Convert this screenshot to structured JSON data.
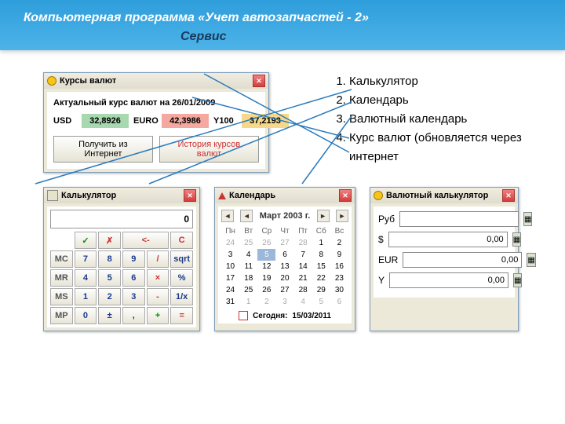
{
  "header": {
    "title": "Компьютерная программа «Учет автозапчастей - 2»",
    "subtitle": "Сервис"
  },
  "ratesWin": {
    "title": "Курсы валют",
    "lineLabel": "Актуальный курс валют на",
    "date": "26/01/2009",
    "usdLabel": "USD",
    "usdVal": "32,8926",
    "eurLabel": "EURO",
    "eurVal": "42,3986",
    "y100Label": "Y100",
    "y100Val": "37,2193",
    "getBtn": "Получить из Интернет",
    "histBtn": "История курсов валют"
  },
  "featureList": [
    "Калькулятор",
    "Календарь",
    "Валютный календарь",
    "Курс валют (обновляется через интернет"
  ],
  "calculator": {
    "title": "Калькулятор",
    "display": "0",
    "keys": {
      "check": "✓",
      "x": "✗",
      "back": "<-",
      "c": "C",
      "mc": "MC",
      "mr": "MR",
      "ms": "MS",
      "mp": "MP",
      "7": "7",
      "8": "8",
      "9": "9",
      "4": "4",
      "5": "5",
      "6": "6",
      "1": "1",
      "2": "2",
      "3": "3",
      "0": "0",
      "div": "/",
      "mul": "×",
      "sub": "-",
      "add": "+",
      "sqrt": "sqrt",
      "pct": "%",
      "inv": "1/x",
      "eq": "=",
      "pm": "±",
      "comma": ","
    }
  },
  "calendar": {
    "title": "Календарь",
    "month": "Март 2003 г.",
    "dh": [
      "Пн",
      "Вт",
      "Ср",
      "Чт",
      "Пт",
      "Сб",
      "Вс"
    ],
    "days": [
      {
        "v": "24",
        "o": 1
      },
      {
        "v": "25",
        "o": 1
      },
      {
        "v": "26",
        "o": 1
      },
      {
        "v": "27",
        "o": 1
      },
      {
        "v": "28",
        "o": 1
      },
      {
        "v": "1"
      },
      {
        "v": "2"
      },
      {
        "v": "3"
      },
      {
        "v": "4"
      },
      {
        "v": "5",
        "t": 1
      },
      {
        "v": "6"
      },
      {
        "v": "7"
      },
      {
        "v": "8"
      },
      {
        "v": "9"
      },
      {
        "v": "10"
      },
      {
        "v": "11"
      },
      {
        "v": "12"
      },
      {
        "v": "13"
      },
      {
        "v": "14"
      },
      {
        "v": "15"
      },
      {
        "v": "16"
      },
      {
        "v": "17"
      },
      {
        "v": "18"
      },
      {
        "v": "19"
      },
      {
        "v": "20"
      },
      {
        "v": "21"
      },
      {
        "v": "22"
      },
      {
        "v": "23"
      },
      {
        "v": "24"
      },
      {
        "v": "25"
      },
      {
        "v": "26"
      },
      {
        "v": "27"
      },
      {
        "v": "28"
      },
      {
        "v": "29"
      },
      {
        "v": "30"
      },
      {
        "v": "31"
      },
      {
        "v": "1",
        "o": 1
      },
      {
        "v": "2",
        "o": 1
      },
      {
        "v": "3",
        "o": 1
      },
      {
        "v": "4",
        "o": 1
      },
      {
        "v": "5",
        "o": 1
      },
      {
        "v": "6",
        "o": 1
      }
    ],
    "todayLabel": "Сегодня:",
    "todayDate": "15/03/2011",
    "prev": "◄",
    "next": "►"
  },
  "currencyCalc": {
    "title": "Валютный калькулятор",
    "rows": [
      {
        "label": "Руб",
        "val": ""
      },
      {
        "label": "$",
        "val": "0,00"
      },
      {
        "label": "EUR",
        "val": "0,00"
      },
      {
        "label": "Y",
        "val": "0,00"
      }
    ]
  }
}
